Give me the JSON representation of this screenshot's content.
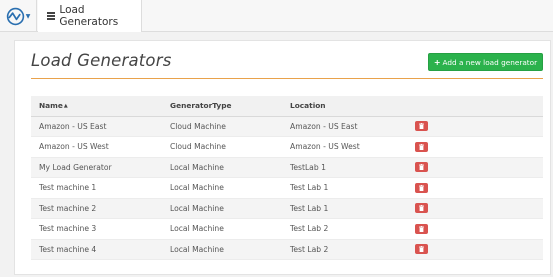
{
  "header": {
    "tab_label": "Load Generators"
  },
  "page": {
    "title": "Load Generators",
    "add_button_label": "Add a new load generator"
  },
  "table": {
    "columns": [
      "Name",
      "GeneratorType",
      "Location"
    ],
    "sort_column": "Name",
    "rows": [
      {
        "name": "Amazon - US East",
        "type": "Cloud Machine",
        "location": "Amazon - US East"
      },
      {
        "name": "Amazon - US West",
        "type": "Cloud Machine",
        "location": "Amazon - US West"
      },
      {
        "name": "My Load Generator",
        "type": "Local Machine",
        "location": "TestLab 1"
      },
      {
        "name": "Test machine 1",
        "type": "Local Machine",
        "location": "Test Lab 1"
      },
      {
        "name": "Test machine 2",
        "type": "Local Machine",
        "location": "Test Lab 1"
      },
      {
        "name": "Test machine 3",
        "type": "Local Machine",
        "location": "Test Lab 2"
      },
      {
        "name": "Test machine 4",
        "type": "Local Machine",
        "location": "Test Lab 2"
      }
    ]
  },
  "colors": {
    "accent_green": "#2bb24c",
    "delete_red": "#d9534f",
    "title_rule_orange": "#e9a24b",
    "logo_blue": "#2a6fb0"
  },
  "icons": {
    "logo": "app-logo-icon",
    "tab": "list-icon",
    "add": "plus-icon",
    "delete": "trash-icon"
  }
}
